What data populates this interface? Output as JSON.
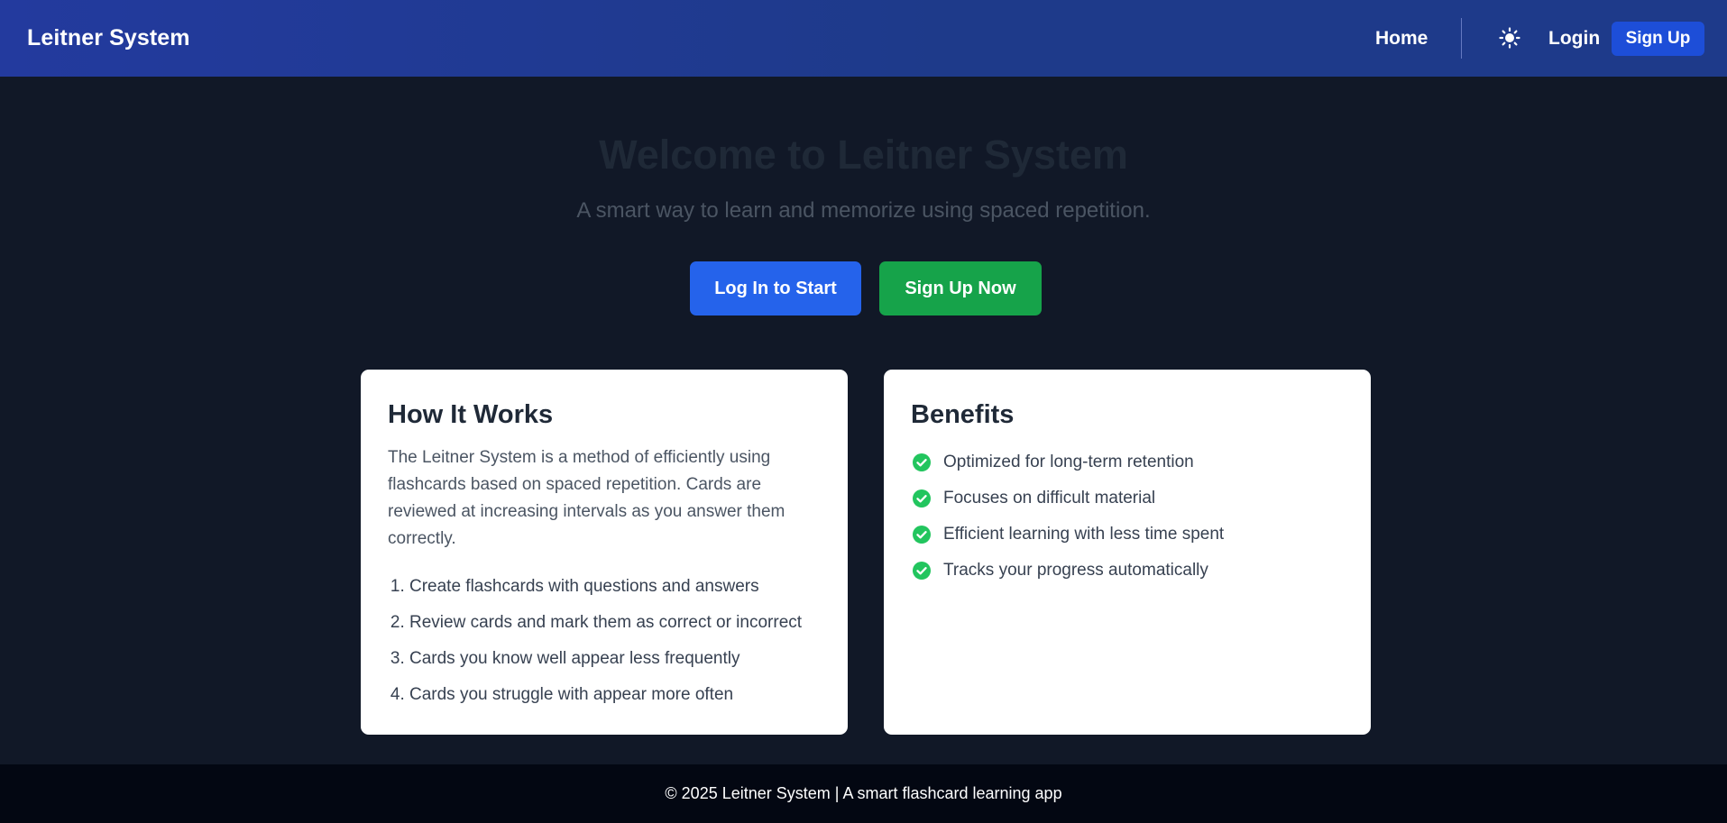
{
  "navbar": {
    "brand": "Leitner System",
    "home_label": "Home",
    "theme_toggle_icon": "sun-icon",
    "login_label": "Login",
    "signup_label": "Sign Up"
  },
  "hero": {
    "title": "Welcome to Leitner System",
    "subtitle": "A smart way to learn and memorize using spaced repetition.",
    "login_button": "Log In to Start",
    "signup_button": "Sign Up Now"
  },
  "how_it_works": {
    "title": "How It Works",
    "description": "The Leitner System is a method of efficiently using flashcards based on spaced repetition. Cards are reviewed at increasing intervals as you answer them correctly.",
    "steps": [
      "Create flashcards with questions and answers",
      "Review cards and mark them as correct or incorrect",
      "Cards you know well appear less frequently",
      "Cards you struggle with appear more often"
    ]
  },
  "benefits": {
    "title": "Benefits",
    "icon": "check-circle-icon",
    "items": [
      "Optimized for long-term retention",
      "Focuses on difficult material",
      "Efficient learning with less time spent",
      "Tracks your progress automatically"
    ]
  },
  "footer": {
    "text": "© 2025 Leitner System | A smart flashcard learning app"
  },
  "colors": {
    "navbar_bg": "#1e3a8a",
    "page_bg": "#111827",
    "primary_button": "#2563eb",
    "success_button": "#16a34a",
    "check_icon": "#22c55e",
    "footer_bg": "#030712"
  }
}
